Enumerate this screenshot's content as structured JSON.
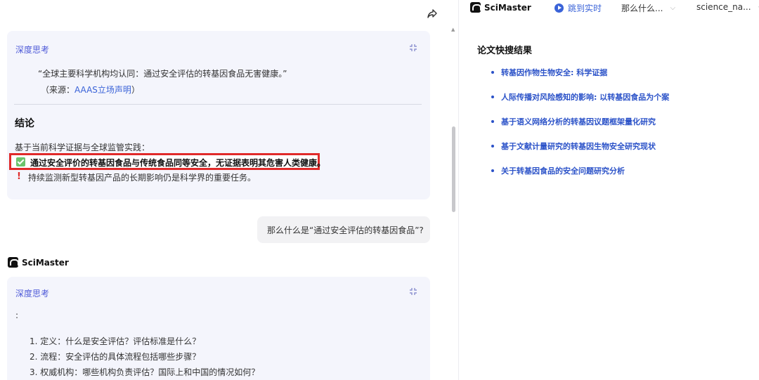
{
  "chat": {
    "card1": {
      "think_label": "深度思考",
      "quote": "“全球主要科学机构均认同：通过安全评估的转基因食品无害健康。”",
      "source_prefix": "（来源：",
      "source_link": "AAAS立场声明",
      "source_suffix": "）",
      "conclusion_title": "结论",
      "basis": "基于当前科学证据与全球监管实践：",
      "highlight": "通过安全评价的转基因食品与传统食品同等安全，无证据表明其危害人类健康。",
      "warning": "持续监测新型转基因产品的长期影响仍是科学界的重要任务。"
    },
    "user_message": "那么什么是“通过安全评估的转基因食品”?",
    "brand": "SciMaster",
    "card2": {
      "think_label": "深度思考",
      "colon": ":",
      "items": [
        "1. 定义：什么是安全评估？评估标准是什么？",
        "2. 流程：安全评估的具体流程包括哪些步骤？",
        "3. 权威机构：哪些机构负责评估？国际上和中国的情况如何？"
      ]
    }
  },
  "header": {
    "brand": "SciMaster",
    "live_label": "跳到实时",
    "dropdown1": "那么什么...",
    "dropdown2": "science_na..."
  },
  "results": {
    "title": "论文快搜结果",
    "items": [
      "转基因作物生物安全: 科学证据",
      "人际传播对风险感知的影响: 以转基因食品为个案",
      "基于语义网络分析的转基因议题框架量化研究",
      "基于文献计量研究的转基因生物安全研究现状",
      "关于转基因食品的安全问题研究分析"
    ]
  },
  "colors": {
    "accent": "#3a63d8",
    "highlight_border": "#e02a2a",
    "card_bg": "#f4f5fc"
  },
  "icons": [
    "share-icon",
    "collapse-icon",
    "check-icon",
    "warning-icon",
    "logo-icon",
    "play-icon",
    "chevron-down-icon"
  ]
}
